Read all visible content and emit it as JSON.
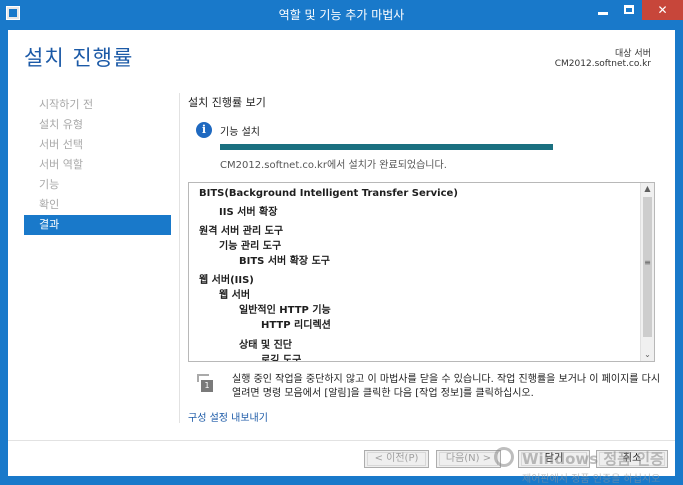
{
  "window": {
    "title": "역할 및 기능 추가 마법사",
    "minimize_icon": "minimize-icon",
    "maximize_icon": "maximize-icon",
    "close_label": "✕"
  },
  "header": {
    "page_title": "설치 진행률",
    "destination_label": "대상 서버",
    "destination_server": "CM2012.softnet.co.kr"
  },
  "steps": [
    {
      "label": "시작하기 전",
      "active": false
    },
    {
      "label": "설치 유형",
      "active": false
    },
    {
      "label": "서버 선택",
      "active": false
    },
    {
      "label": "서버 역할",
      "active": false
    },
    {
      "label": "기능",
      "active": false
    },
    {
      "label": "확인",
      "active": false
    },
    {
      "label": "결과",
      "active": true
    }
  ],
  "main": {
    "section_title": "설치 진행률 보기",
    "info_icon_glyph": "i",
    "info_label": "기능 설치",
    "progress_fraction": 1.0,
    "status_text": "CM2012.softnet.co.kr에서 설치가 완료되었습니다.",
    "results": [
      {
        "text": "BITS(Background Intelligent Transfer Service)",
        "level": 0
      },
      {
        "text": "IIS 서버 확장",
        "level": 1
      },
      {
        "text": "원격 서버 관리 도구",
        "level": 0
      },
      {
        "text": "기능 관리 도구",
        "level": 1
      },
      {
        "text": "BITS 서버 확장 도구",
        "level": 2
      },
      {
        "text": "웹 서버(IIS)",
        "level": 0
      },
      {
        "text": "웹 서버",
        "level": 1
      },
      {
        "text": "일반적인 HTTP 기능",
        "level": 2
      },
      {
        "text": "HTTP 리디렉션",
        "level": 3
      },
      {
        "text": "상태 및 진단",
        "level": 2
      },
      {
        "text": "로깅 도구",
        "level": 3
      }
    ],
    "notice_badge": "1",
    "notice_text": "실행 중인 작업을 중단하지 않고 이 마법사를 닫을 수 있습니다. 작업 진행률을 보거나 이 페이지를 다시 열려면 명령 모음에서 [알림]을 클릭한 다음 [작업 정보]를 클릭하십시오.",
    "export_link": "구성 설정 내보내기"
  },
  "footer": {
    "prev_label": "< 이전(P)",
    "next_label": "다음(N) >",
    "close_label": "닫기",
    "cancel_label": "취소"
  },
  "watermark": {
    "text": "Windows 정품 인증",
    "sub": "제어판에서 정품 인증을 하십시오"
  }
}
